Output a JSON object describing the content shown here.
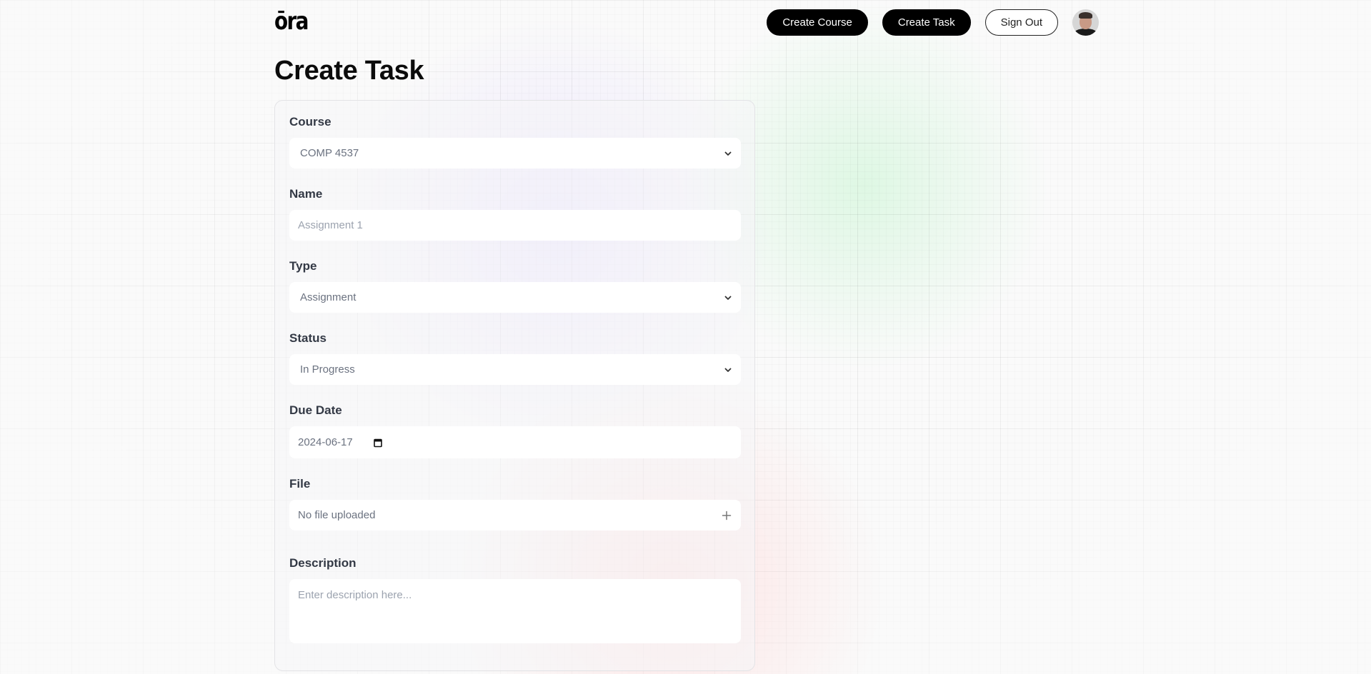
{
  "brand": {
    "logo_text": "ōra"
  },
  "nav": {
    "create_course_label": "Create Course",
    "create_task_label": "Create Task",
    "sign_out_label": "Sign Out",
    "avatar_icon": "user-avatar"
  },
  "page": {
    "title": "Create Task"
  },
  "form": {
    "course": {
      "label": "Course",
      "value": "COMP 4537",
      "icon": "chevron-down-icon"
    },
    "name": {
      "label": "Name",
      "placeholder": "Assignment 1",
      "value": ""
    },
    "type": {
      "label": "Type",
      "value": "Assignment",
      "icon": "chevron-down-icon"
    },
    "status": {
      "label": "Status",
      "value": "In Progress",
      "icon": "chevron-down-icon"
    },
    "due_date": {
      "label": "Due Date",
      "value": "2024-06-17",
      "icon": "calendar-icon"
    },
    "file": {
      "label": "File",
      "value": "No file uploaded",
      "icon": "plus-icon"
    },
    "description": {
      "label": "Description",
      "placeholder": "Enter description here...",
      "value": ""
    }
  },
  "colors": {
    "primary_button_bg": "#000000",
    "primary_button_text": "#ffffff",
    "label_text": "#333945",
    "placeholder_text": "#9ca3af",
    "value_text": "#6b7280"
  }
}
